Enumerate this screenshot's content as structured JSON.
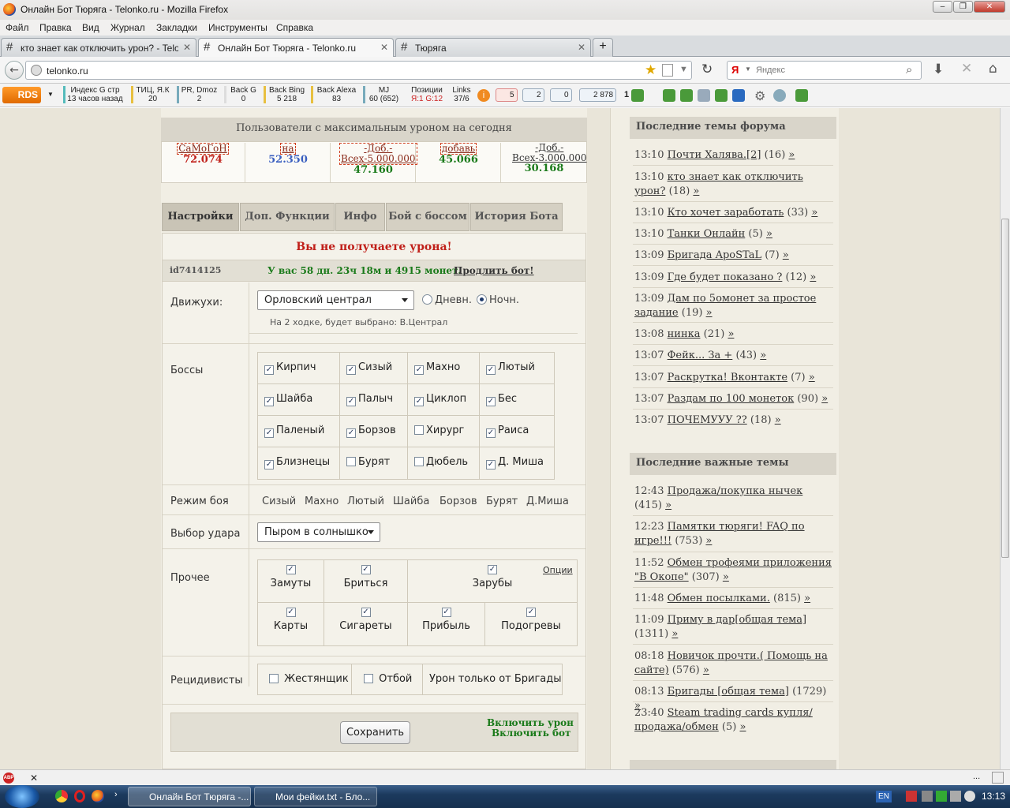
{
  "window": {
    "title": "Онлайн Бот Тюряга - Telonko.ru - Mozilla Firefox",
    "min": "‒",
    "max": "❐",
    "close": "✕"
  },
  "menu": [
    "Файл",
    "Правка",
    "Вид",
    "Журнал",
    "Закладки",
    "Инструменты",
    "Справка"
  ],
  "tabs": [
    {
      "label": "кто знает как отключить урон? - Telo...",
      "close": "✕"
    },
    {
      "label": "Онлайн Бот Тюряга - Telonko.ru",
      "close": "✕"
    },
    {
      "label": "Тюряга",
      "close": "✕"
    }
  ],
  "new_tab": "+",
  "nav": {
    "url": "telonko.ru",
    "search_placeholder": "Яндекс"
  },
  "rds": {
    "logo": "RDS",
    "items": [
      {
        "top": "Индекс G стр",
        "bottom": "13 часов назад"
      },
      {
        "top": "ТИЦ, Я.К",
        "bottom": "20"
      },
      {
        "top": "PR, Dmoz",
        "bottom": "2"
      },
      {
        "top": "Back G",
        "bottom": "0"
      },
      {
        "top": "Back Bing",
        "bottom": "5 218"
      },
      {
        "top": "Back Alexa",
        "bottom": "83"
      },
      {
        "top": "MJ",
        "bottom": "60 (652)"
      },
      {
        "top": "Позиции",
        "bottom": "Я:1 G:12"
      },
      {
        "top": "Links",
        "bottom": "37/6"
      }
    ],
    "g_plus": "5",
    "likes": "2",
    "twitter": "0",
    "vk": "2 878",
    "one": "1"
  },
  "top_users": {
    "title": "Пользователи с максимальным уроном на сегодня",
    "users": [
      {
        "name": "СаМоГоН",
        "value": "72.074",
        "color": "#c0201a"
      },
      {
        "name": "на",
        "value": "52.350",
        "color": "#3a5fc0"
      },
      {
        "name": "-Доб.-Всех-5.000.000",
        "value": "47.160",
        "color": "#1a7a1a"
      },
      {
        "name": "добавь",
        "value": "45.066",
        "color": "#1a7a1a"
      },
      {
        "name": "-Доб.-Всех-3.000.000",
        "value": "30.168",
        "color": "#1a7a1a"
      }
    ]
  },
  "main_tabs": [
    "Настройки",
    "Доп. Функции",
    "Инфо",
    "Бой с боссом",
    "История Бота"
  ],
  "warning": "Вы не получаете урона!",
  "account": {
    "id": "id7414125",
    "status": "У вас 58 дн. 23ч 18м и 4915 монет.",
    "extend": "Продлить бот!"
  },
  "moves": {
    "label": "Движухи:",
    "selected": "Орловский централ",
    "day": "Дневн.",
    "night": "Ночн.",
    "night_selected": true,
    "note": "На 2 ходке, будет выбрано: В.Централ"
  },
  "bosses": {
    "label": "Боссы",
    "items": [
      {
        "name": "Кирпич",
        "checked": true
      },
      {
        "name": "Сизый",
        "checked": true
      },
      {
        "name": "Махно",
        "checked": true
      },
      {
        "name": "Лютый",
        "checked": true
      },
      {
        "name": "Шайба",
        "checked": true
      },
      {
        "name": "Палыч",
        "checked": true
      },
      {
        "name": "Циклоп",
        "checked": true
      },
      {
        "name": "Бес",
        "checked": true
      },
      {
        "name": "Паленый",
        "checked": true
      },
      {
        "name": "Борзов",
        "checked": true
      },
      {
        "name": "Хирург",
        "checked": false
      },
      {
        "name": "Раиса",
        "checked": true
      },
      {
        "name": "Близнецы",
        "checked": true
      },
      {
        "name": "Бурят",
        "checked": false
      },
      {
        "name": "Дюбель",
        "checked": false
      },
      {
        "name": "Д. Миша",
        "checked": true
      }
    ]
  },
  "fight_mode": {
    "label": "Режим боя",
    "items": [
      "Сизый",
      "Махно",
      "Лютый",
      "Шайба",
      "Борзов",
      "Бурят",
      "Д.Миша"
    ]
  },
  "strike": {
    "label": "Выбор удара",
    "selected": "Пыром в солнышко"
  },
  "other": {
    "label": "Прочее",
    "options_link": "Опции",
    "items": [
      {
        "name": "Замуты",
        "checked": true
      },
      {
        "name": "Бриться",
        "checked": true
      },
      {
        "name": "Зарубы",
        "checked": true
      },
      {
        "name": "Карты",
        "checked": true
      },
      {
        "name": "Сигареты",
        "checked": true
      },
      {
        "name": "Прибыль",
        "checked": true
      },
      {
        "name": "Подогревы",
        "checked": true
      }
    ]
  },
  "recidivists": {
    "label": "Рецидивисты",
    "items": [
      {
        "name": "Жестянщик",
        "checked": false
      },
      {
        "name": "Отбой",
        "checked": false
      }
    ],
    "note": "Урон только от Бригады"
  },
  "save": {
    "button": "Сохранить",
    "enable_damage": "Включить урон",
    "enable_bot": "Включить бот"
  },
  "forum": {
    "title": "Последние темы форума",
    "topics": [
      {
        "time": "13:10",
        "title": "Почти Халява.[2]",
        "count": "(16)"
      },
      {
        "time": "13:10",
        "title": "кто знает как отключить урон?",
        "count": "(18)"
      },
      {
        "time": "13:10",
        "title": "Кто хочет заработать",
        "count": "(33)"
      },
      {
        "time": "13:10",
        "title": "Танки Онлайн",
        "count": "(5)"
      },
      {
        "time": "13:09",
        "title": "Бригада ApoSTaL",
        "count": "(7)"
      },
      {
        "time": "13:09",
        "title": "Где будет показано ?",
        "count": "(12)"
      },
      {
        "time": "13:09",
        "title": "Дам по 5омонет за простое задание",
        "count": "(19)"
      },
      {
        "time": "13:08",
        "title": "нинка",
        "count": "(21)"
      },
      {
        "time": "13:07",
        "title": "Фейк... За +",
        "count": "(43)"
      },
      {
        "time": "13:07",
        "title": "Раскрутка! Вконтакте",
        "count": "(7)"
      },
      {
        "time": "13:07",
        "title": "Раздам по 100 монеток",
        "count": "(90)"
      },
      {
        "time": "13:07",
        "title": "ПОЧЕМУУУ ??",
        "count": "(18)"
      }
    ],
    "more": "»"
  },
  "important": {
    "title": "Последние важные темы",
    "topics": [
      {
        "time": "12:43",
        "title": "Продажа/покупка нычек",
        "count": "(415)"
      },
      {
        "time": "12:23",
        "title": "Памятки тюряги! FAQ по игре!!!",
        "count": "(753)"
      },
      {
        "time": "11:52",
        "title": "Обмен трофеями приложения \"В Окопе\"",
        "count": "(307)"
      },
      {
        "time": "11:48",
        "title": "Обмен посылками.",
        "count": "(815)"
      },
      {
        "time": "11:09",
        "title": "Приму в дар[общая тема]",
        "count": "(1311)"
      },
      {
        "time": "08:18",
        "title": "Новичок прочти.( Помощь на сайте)",
        "count": "(576)"
      },
      {
        "time": "08:13",
        "title": "Бригады [общая тема]",
        "count": "(1729)"
      },
      {
        "time": "23:40",
        "title": "Steam trading cards купля/продажа/обмен",
        "count": "(5)"
      }
    ]
  },
  "statusbar": {
    "close": "✕",
    "dots": "..."
  },
  "taskbar": {
    "items": [
      "Онлайн Бот Тюряга -...",
      "Мои фейки.txt - Бло..."
    ],
    "lang": "EN",
    "time": "13:13"
  },
  "colors": {
    "accent_red": "#c0201a",
    "accent_green": "#1a7a1a",
    "panel_bg": "#f4f2ea"
  }
}
